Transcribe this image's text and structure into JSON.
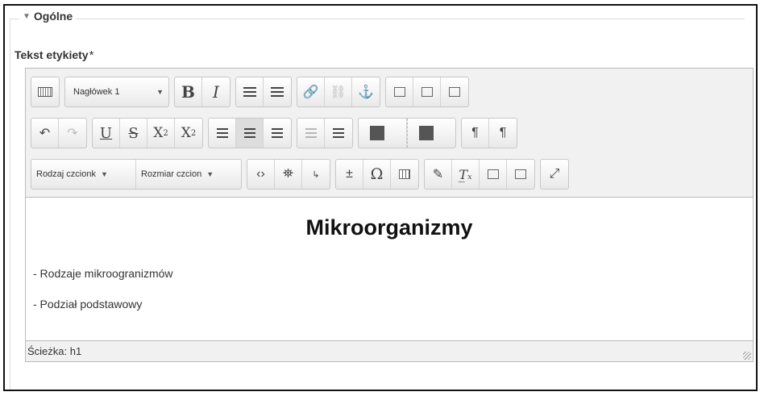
{
  "section": {
    "title": "Ogólne"
  },
  "field": {
    "label": "Tekst etykiety",
    "required_mark": "*"
  },
  "toolbar": {
    "block_format": "Nagłówek 1",
    "font_family": "Rodzaj czcionk",
    "font_size": "Rozmiar czcion",
    "bold": "B",
    "italic": "I",
    "underline": "U",
    "strikethrough": "S",
    "subscript_base": "X",
    "subscript_mark": "2",
    "superscript_base": "X",
    "superscript_mark": "2",
    "ltr": "¶",
    "rtl": "¶",
    "omega": "Ω"
  },
  "editor_content": {
    "heading": "Mikroorganizmy",
    "lines": [
      "- Rodzaje mikroogranizmów",
      "- Podział podstawowy"
    ]
  },
  "statusbar": {
    "path": "Ścieżka: h1"
  }
}
